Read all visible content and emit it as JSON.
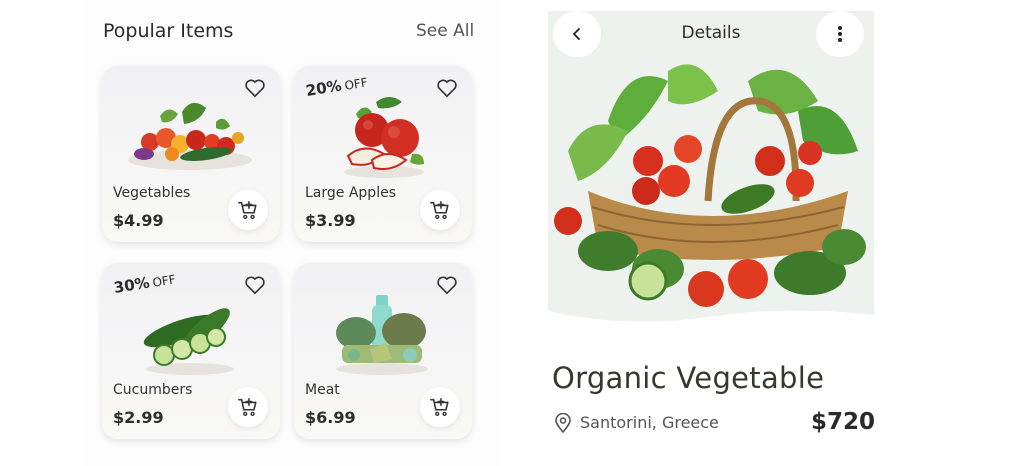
{
  "popular": {
    "title": "Popular Items",
    "see_all": "See All",
    "items": [
      {
        "name": "Vegetables",
        "price": "$4.99",
        "discount": "",
        "discount_off": ""
      },
      {
        "name": "Large Apples",
        "price": "$3.99",
        "discount": "20%",
        "discount_off": "OFF"
      },
      {
        "name": "Cucumbers",
        "price": "$2.99",
        "discount": "30%",
        "discount_off": "OFF"
      },
      {
        "name": "Meat",
        "price": "$6.99",
        "discount": "",
        "discount_off": ""
      }
    ]
  },
  "details": {
    "header": "Details",
    "product_title": "Organic Vegetable",
    "location": "Santorini, Greece",
    "price": "$720"
  },
  "icons": {
    "back": "chevron-left-icon",
    "more": "more-vertical-icon",
    "favorite": "heart-icon",
    "cart": "cart-add-icon",
    "location": "location-pin-icon"
  },
  "colors": {
    "title_dark": "#343a2a",
    "card_bg": "#f3f3f4"
  }
}
